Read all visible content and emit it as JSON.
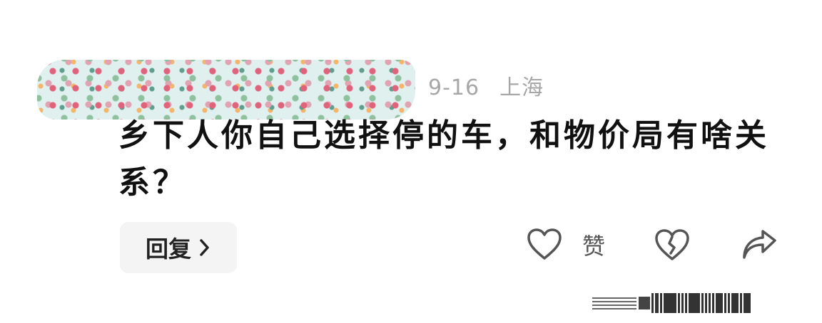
{
  "comment": {
    "date": "9-16",
    "location": "上海",
    "text": "乡下人你自己选择停的车，和物价局有啥关系？"
  },
  "actions": {
    "reply_label": "回复",
    "like_label": "赞"
  },
  "icons": {
    "reply_chevron": "chevron-right-icon",
    "like": "heart-outline-icon",
    "dislike": "broken-heart-icon",
    "share": "share-arrow-icon"
  },
  "colors": {
    "background": "#ffffff",
    "text": "#111111",
    "meta": "#a7a7a7",
    "button_bg": "#f4f4f4",
    "icon": "#555555"
  }
}
